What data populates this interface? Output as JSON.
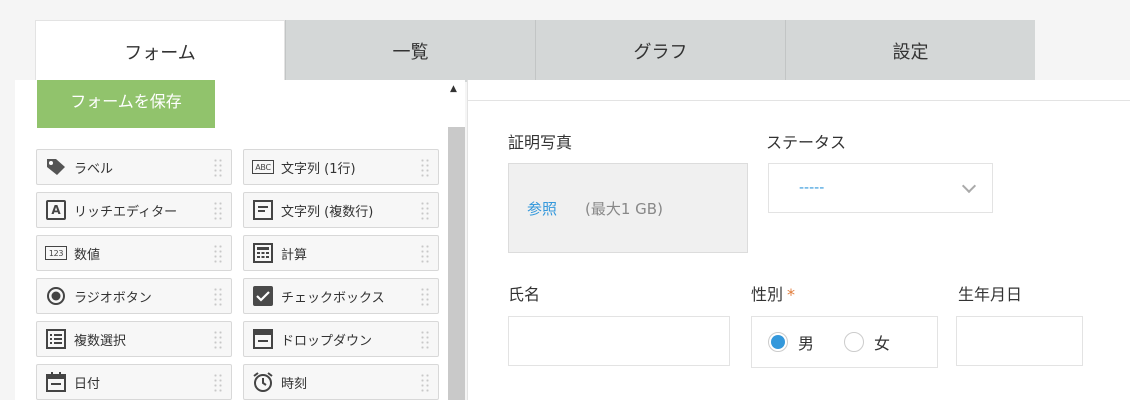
{
  "tabs": [
    {
      "label": "フォーム",
      "active": true
    },
    {
      "label": "一覧",
      "active": false
    },
    {
      "label": "グラフ",
      "active": false
    },
    {
      "label": "設定",
      "active": false
    }
  ],
  "palette": {
    "save_label": "フォームを保存",
    "fields": [
      {
        "label": "ラベル",
        "icon": "tag-icon"
      },
      {
        "label": "文字列 (1行)",
        "icon": "abc-icon",
        "icon_text": "ABC"
      },
      {
        "label": "リッチエディター",
        "icon": "rich-editor-icon",
        "icon_text": "A"
      },
      {
        "label": "文字列 (複数行)",
        "icon": "multiline-text-icon"
      },
      {
        "label": "数値",
        "icon": "number-icon",
        "icon_text": "123"
      },
      {
        "label": "計算",
        "icon": "calculator-icon"
      },
      {
        "label": "ラジオボタン",
        "icon": "radio-icon"
      },
      {
        "label": "チェックボックス",
        "icon": "checkbox-icon"
      },
      {
        "label": "複数選択",
        "icon": "multi-select-icon"
      },
      {
        "label": "ドロップダウン",
        "icon": "dropdown-icon"
      },
      {
        "label": "日付",
        "icon": "calendar-icon"
      },
      {
        "label": "時刻",
        "icon": "clock-icon"
      }
    ]
  },
  "form": {
    "photo_label": "証明写真",
    "photo_browse": "参照",
    "photo_limit": "(最大1 GB)",
    "status_label": "ステータス",
    "status_value": "-----",
    "name_label": "氏名",
    "gender_label": "性別",
    "gender_required": "*",
    "gender_options": [
      "男",
      "女"
    ],
    "birthday_label": "生年月日"
  },
  "colors": {
    "save_button": "#91c36c",
    "accent": "#3498db",
    "required": "#e07b39"
  }
}
